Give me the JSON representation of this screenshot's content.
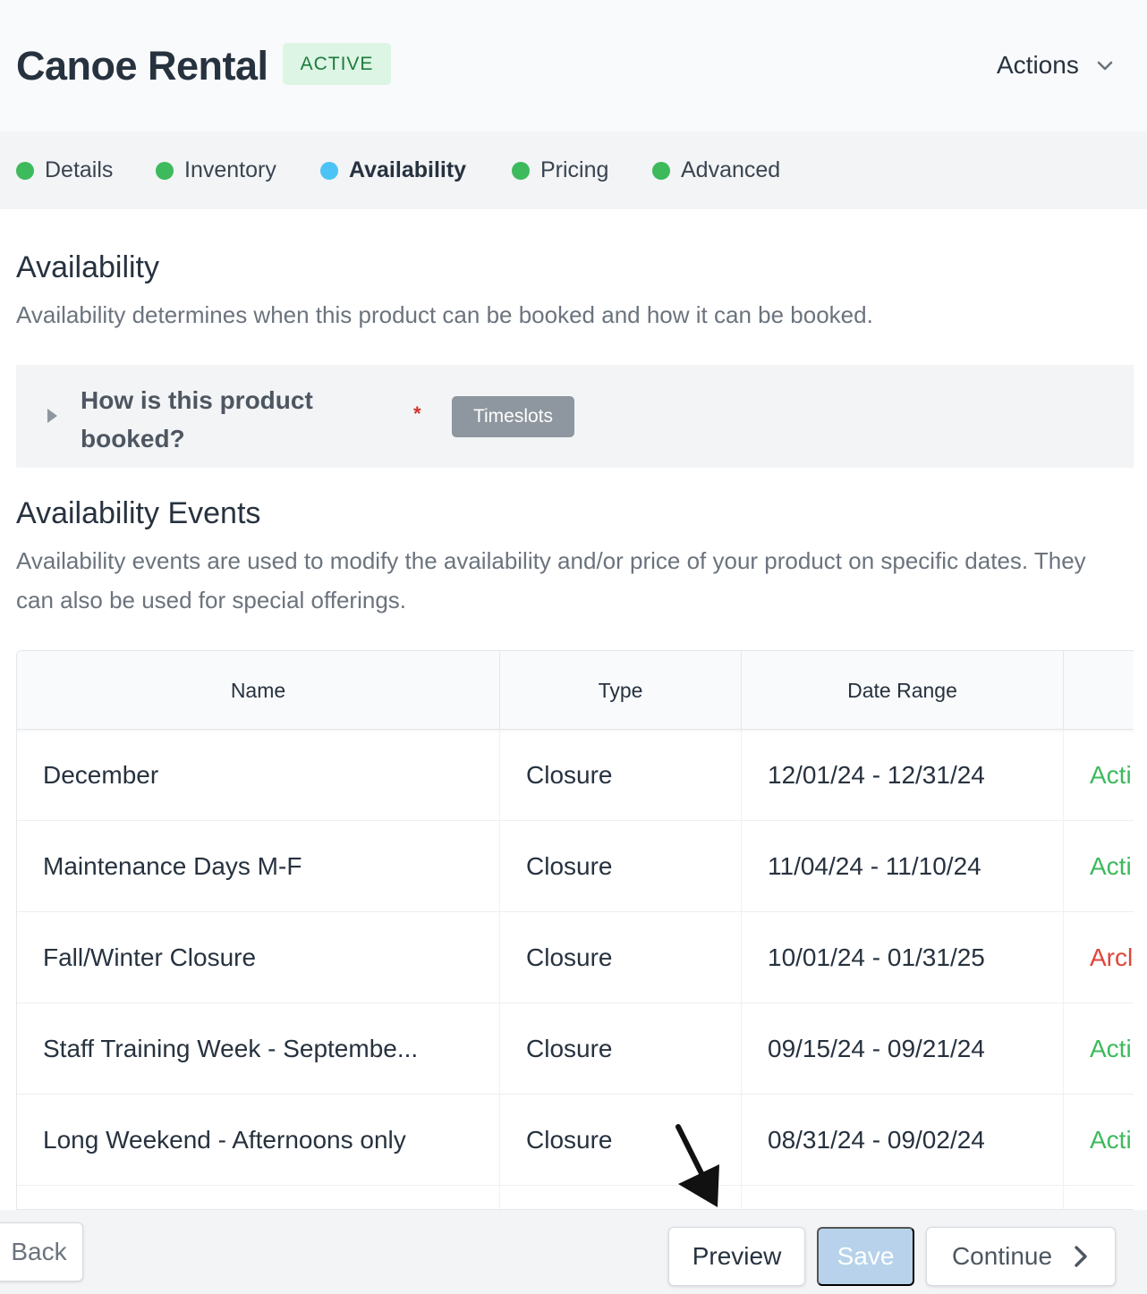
{
  "header": {
    "title": "Canoe Rental",
    "status": "ACTIVE",
    "actions_label": "Actions"
  },
  "steps": [
    {
      "label": "Details",
      "state": "complete",
      "color": "#3dba5c"
    },
    {
      "label": "Inventory",
      "state": "complete",
      "color": "#3dba5c"
    },
    {
      "label": "Availability",
      "state": "current",
      "color": "#4cc3f5"
    },
    {
      "label": "Pricing",
      "state": "complete",
      "color": "#3dba5c"
    },
    {
      "label": "Advanced",
      "state": "complete",
      "color": "#3dba5c"
    }
  ],
  "availability": {
    "title": "Availability",
    "description": "Availability determines when this product can be booked and how it can be booked.",
    "booking_question": "How is this product booked?",
    "required_mark": "*",
    "booking_value": "Timeslots"
  },
  "events": {
    "title": "Availability Events",
    "description": "Availability events are used to modify the availability and/or price of your product on specific dates. They can also be used for special offerings.",
    "columns": [
      "Name",
      "Type",
      "Date Range"
    ],
    "rows": [
      {
        "name": "December",
        "type": "Closure",
        "date_range": "12/01/24 - 12/31/24",
        "status": "Acti",
        "status_color": "#3dba5c"
      },
      {
        "name": "Maintenance Days M-F",
        "type": "Closure",
        "date_range": "11/04/24 - 11/10/24",
        "status": "Acti",
        "status_color": "#3dba5c"
      },
      {
        "name": "Fall/Winter Closure",
        "type": "Closure",
        "date_range": "10/01/24 - 01/31/25",
        "status": "Arcl",
        "status_color": "#e0453a"
      },
      {
        "name": "Staff Training Week - Septembe...",
        "type": "Closure",
        "date_range": "09/15/24 - 09/21/24",
        "status": "Acti",
        "status_color": "#3dba5c"
      },
      {
        "name": "Long Weekend - Afternoons only",
        "type": "Closure",
        "date_range": "08/31/24 - 09/02/24",
        "status": "Acti",
        "status_color": "#3dba5c"
      }
    ]
  },
  "footer": {
    "back_label": "Back",
    "preview_label": "Preview",
    "save_label": "Save",
    "continue_label": "Continue"
  },
  "icons": {
    "actions": "chevron-down-icon",
    "booking_toggle": "caret-right-icon",
    "continue": "chevron-right-icon",
    "annotation": "arrow-annotation-icon"
  }
}
